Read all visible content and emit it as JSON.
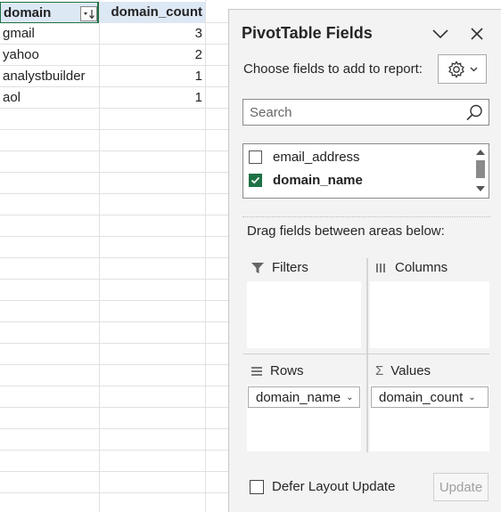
{
  "sheet": {
    "header": {
      "col_a": "domain",
      "col_b": "domain_count"
    },
    "rows": [
      {
        "domain": "gmail",
        "count": "3"
      },
      {
        "domain": "yahoo",
        "count": "2"
      },
      {
        "domain": "analystbuilder",
        "count": "1"
      },
      {
        "domain": "aol",
        "count": "1"
      }
    ]
  },
  "pane": {
    "title": "PivotTable Fields",
    "choose_label": "Choose fields to add to report:",
    "search_placeholder": "Search",
    "fields": [
      {
        "label": "email_address",
        "checked": false
      },
      {
        "label": "domain_name",
        "checked": true
      }
    ],
    "drag_label": "Drag fields between areas below:",
    "areas": {
      "filters": {
        "title": "Filters"
      },
      "columns": {
        "title": "Columns"
      },
      "rows": {
        "title": "Rows",
        "item": "domain_name"
      },
      "values": {
        "title": "Values",
        "item": "domain_count"
      }
    },
    "defer_label": "Defer Layout Update",
    "update_label": "Update"
  },
  "colors": {
    "accent": "#1e7145",
    "header_fill": "#dde8f5",
    "pane_bg": "#f3f3f3"
  },
  "icons": [
    "filter-sort-icon",
    "chevron-down-icon",
    "close-icon",
    "gear-icon",
    "search-icon",
    "filter-icon",
    "columns-icon",
    "rows-icon",
    "sigma-icon"
  ]
}
